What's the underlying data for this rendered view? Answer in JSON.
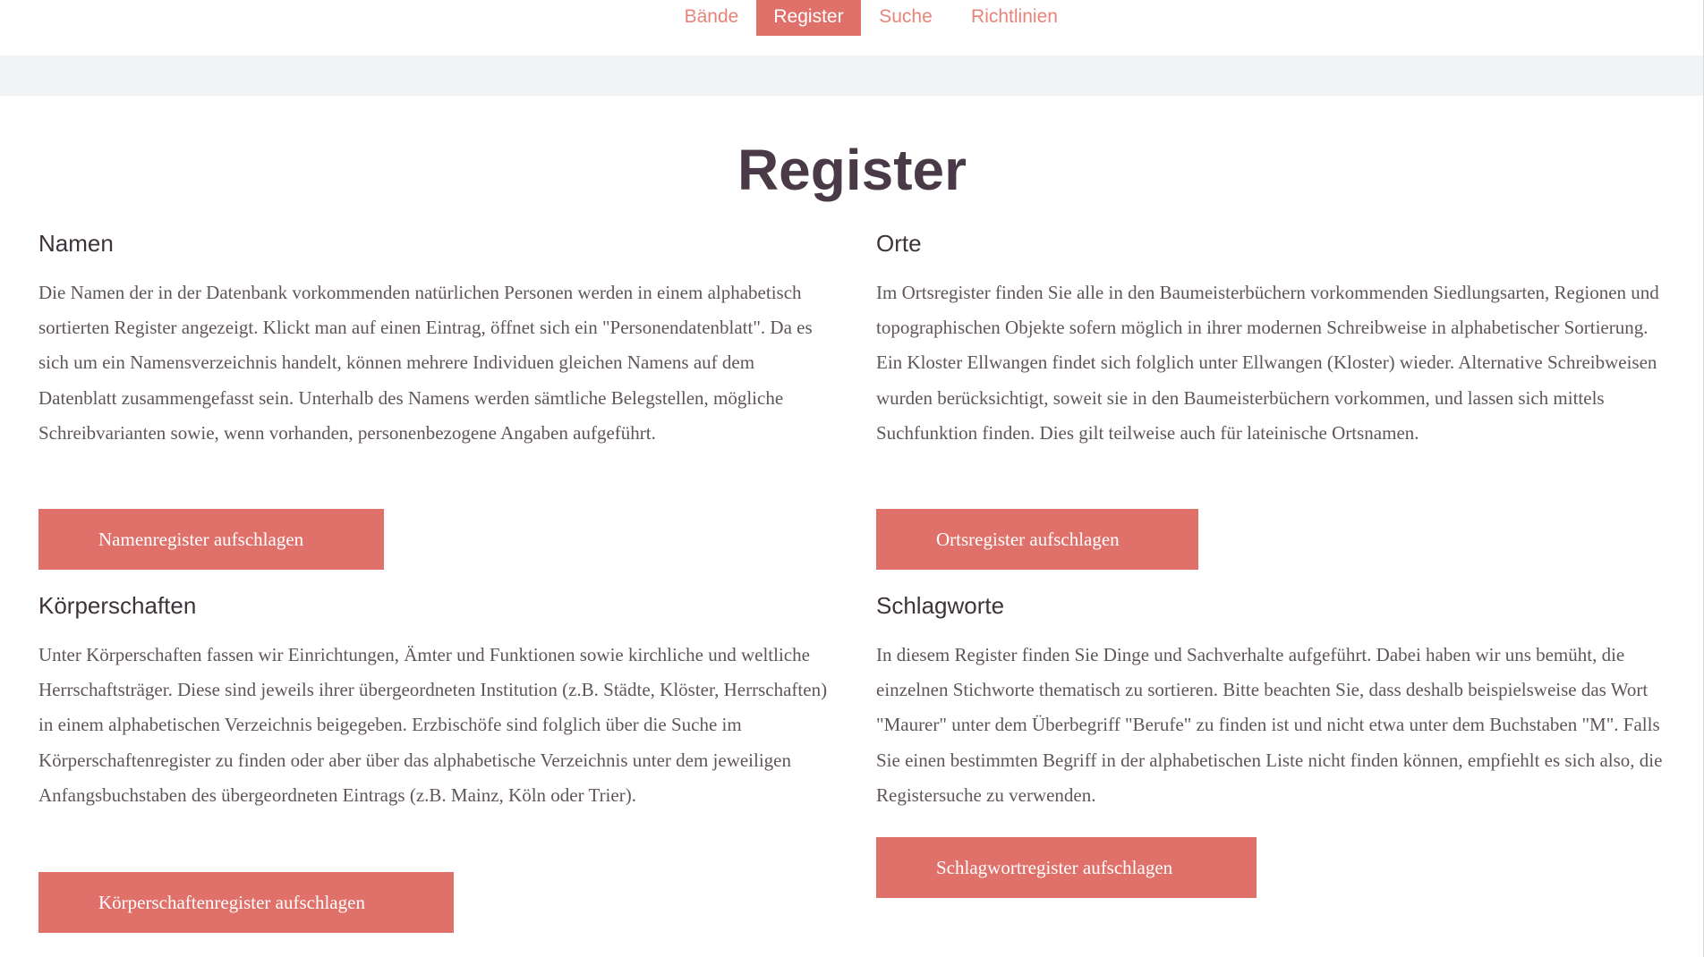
{
  "nav": {
    "items": [
      {
        "label": "Bände"
      },
      {
        "label": "Register"
      },
      {
        "label": "Suche"
      },
      {
        "label": "Richtlinien"
      }
    ],
    "active": "Register"
  },
  "page_title": "Register",
  "sections": [
    {
      "heading": "Namen",
      "text": "Die Namen der in der Datenbank vorkommenden natürlichen Personen werden in einem alphabetisch sortierten Register angezeigt. Klickt man auf einen Eintrag, öffnet sich ein \"Personendatenblatt\". Da es sich um ein Namensverzeichnis handelt, können mehrere Individuen gleichen Namens auf dem Datenblatt zusammengefasst sein. Unterhalb des Namens werden sämtliche Belegstellen, mögliche Schreibvarianten sowie, wenn vorhanden, personenbezogene Angaben aufgeführt.",
      "button": "Namenregister aufschlagen"
    },
    {
      "heading": "Orte",
      "text": "Im Ortsregister finden Sie alle in den Baumeisterbüchern vorkommenden Siedlungsarten, Regionen und topographischen Objekte sofern möglich in ihrer modernen Schreibweise in alphabetischer Sortierung. Ein Kloster Ellwangen findet sich folglich unter Ellwangen (Kloster) wieder. Alternative Schreibweisen wurden berücksichtigt, soweit sie in den Baumeisterbüchern vorkommen, und lassen sich mittels Suchfunktion finden. Dies gilt teilweise auch für lateinische Ortsnamen.",
      "button": "Ortsregister aufschlagen"
    },
    {
      "heading": "Körperschaften",
      "text": "Unter Körperschaften fassen wir Einrichtungen, Ämter und Funktionen sowie kirchliche und weltliche Herrschaftsträger. Diese sind jeweils ihrer übergeordneten Institution (z.B. Städte, Klöster, Herrschaften) in einem alphabetischen Verzeichnis beigegeben. Erzbischöfe sind folglich über die Suche im Körperschaftenregister zu finden oder aber über das alphabetische Verzeichnis unter dem jeweiligen Anfangsbuchstaben des übergeordneten Eintrags (z.B. Mainz, Köln oder Trier).",
      "button": "Körperschaftenregister aufschlagen"
    },
    {
      "heading": "Schlagworte",
      "text": "In diesem Register finden Sie Dinge und Sachverhalte aufgeführt. Dabei haben wir uns bemüht, die einzelnen Stichworte thematisch zu sortieren. Bitte beachten Sie, dass deshalb beispielsweise das Wort \"Maurer\" unter dem Überbegriff \"Berufe\" zu finden ist und nicht etwa unter dem Buchstaben \"M\". Falls Sie einen bestimmten Begriff in der alphabetischen Liste nicht finden können, empfiehlt es sich also, die Registersuche zu verwenden.",
      "button": "Schlagwortregister aufschlagen"
    }
  ],
  "colors": {
    "accent": "#e0716a",
    "nav_text": "#e8837a",
    "band": "#f1f3f4"
  }
}
